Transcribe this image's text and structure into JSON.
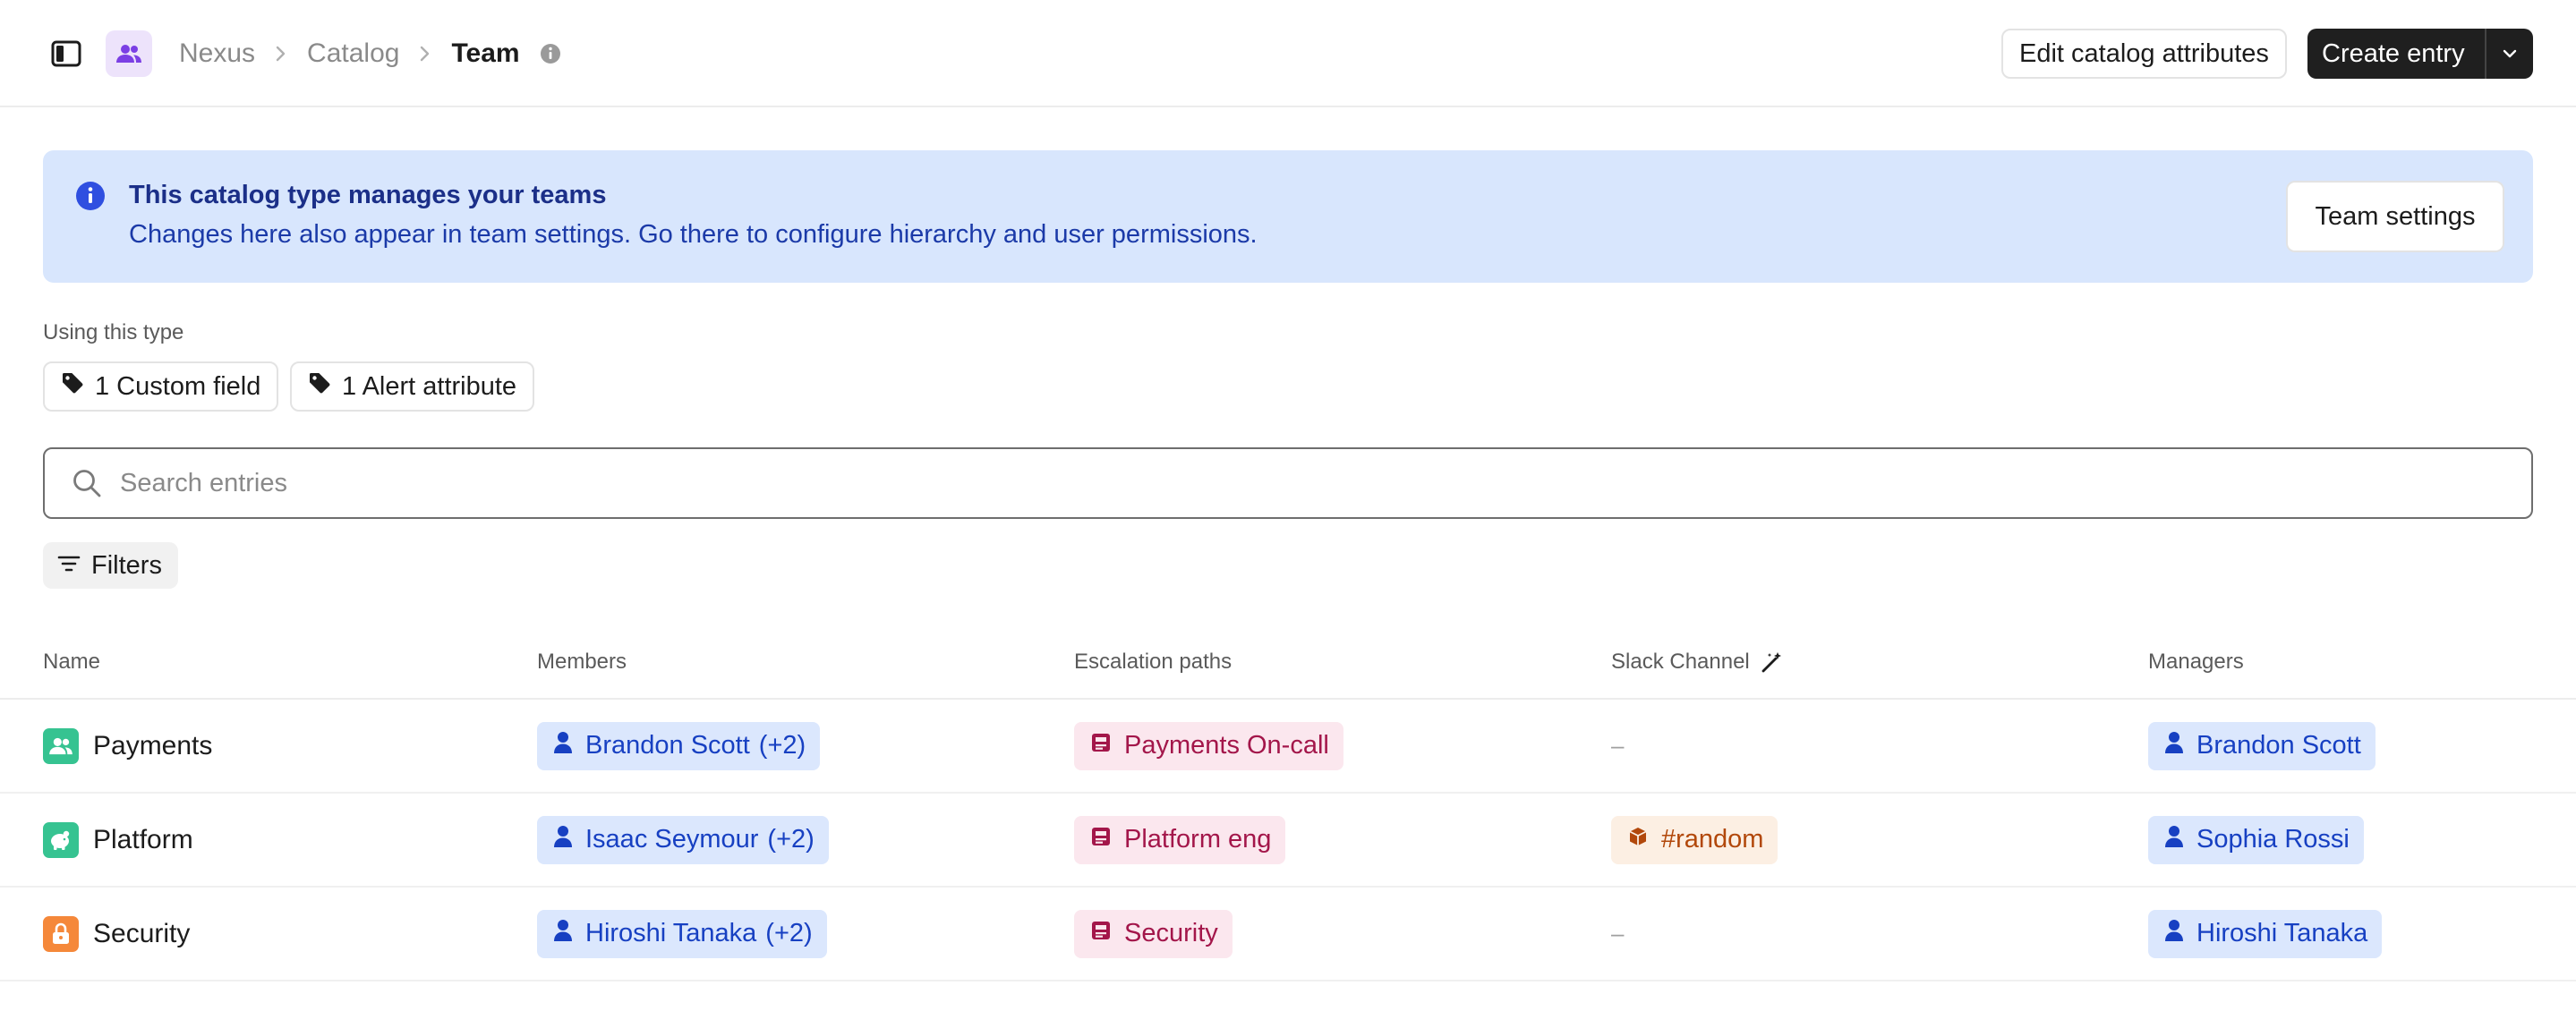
{
  "header": {
    "breadcrumbs": [
      "Nexus",
      "Catalog",
      "Team"
    ],
    "edit_label": "Edit catalog attributes",
    "create_label": "Create entry"
  },
  "banner": {
    "title": "This catalog type manages your teams",
    "body": "Changes here also appear in team settings. Go there to configure hierarchy and user permissions.",
    "button": "Team settings"
  },
  "usage": {
    "label": "Using this type",
    "custom_field": "1 Custom field",
    "alert_attribute": "1 Alert attribute"
  },
  "search": {
    "placeholder": "Search entries"
  },
  "filters_label": "Filters",
  "table": {
    "columns": [
      "Name",
      "Members",
      "Escalation paths",
      "Slack Channel",
      "Managers"
    ],
    "rows": [
      {
        "name": "Payments",
        "icon": "users-icon",
        "icon_color": "#36c391",
        "member": "Brandon Scott",
        "member_extra": "(+2)",
        "escalation": "Payments On-call",
        "slack": "–",
        "manager": "Brandon Scott"
      },
      {
        "name": "Platform",
        "icon": "piggy-bank-icon",
        "icon_color": "#36c391",
        "member": "Isaac Seymour",
        "member_extra": "(+2)",
        "escalation": "Platform eng",
        "slack": "#random",
        "manager": "Sophia Rossi"
      },
      {
        "name": "Security",
        "icon": "lock-icon",
        "icon_color": "#f5883a",
        "member": "Hiroshi Tanaka",
        "member_extra": "(+2)",
        "escalation": "Security",
        "slack": "–",
        "manager": "Hiroshi Tanaka"
      }
    ]
  },
  "colors": {
    "accent_purple": "#7b3fe4",
    "banner_bg": "#d8e6fd",
    "user_chip": "#dbe7fd",
    "escalation_chip": "#fbe7ee",
    "slack_chip": "#fcefe3",
    "primary_button": "#1f1f1f"
  }
}
